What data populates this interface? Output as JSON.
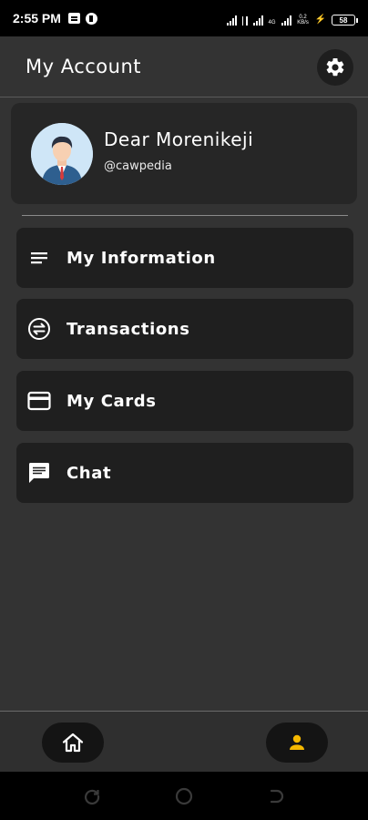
{
  "status_bar": {
    "time": "2:55 PM",
    "battery_level": "58",
    "network_label_1": "4G",
    "network_label_2": "0.2 KB/s"
  },
  "header": {
    "title": "My Account",
    "settings_icon": "gear-icon"
  },
  "profile": {
    "name": "Dear Morenikeji",
    "handle": "@cawpedia",
    "avatar_icon": "user-avatar"
  },
  "menu": {
    "items": [
      {
        "label": "My Information",
        "icon": "lines-icon"
      },
      {
        "label": "Transactions",
        "icon": "swap-icon"
      },
      {
        "label": "My Cards",
        "icon": "card-icon"
      },
      {
        "label": "Chat",
        "icon": "chat-icon"
      }
    ]
  },
  "bottom_nav": {
    "items": [
      {
        "name": "home",
        "icon": "home-icon",
        "active": false
      },
      {
        "name": "account",
        "icon": "person-icon",
        "active": true
      }
    ]
  },
  "colors": {
    "background": "#333333",
    "card": "#1f1f1f",
    "active_accent": "#f5b800"
  }
}
